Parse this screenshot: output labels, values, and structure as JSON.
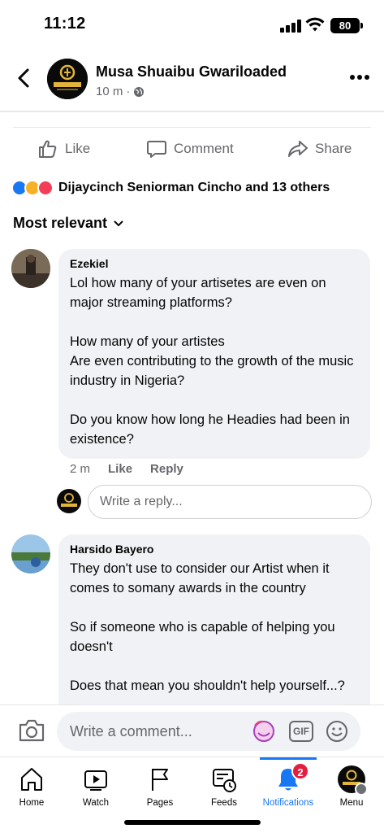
{
  "status_bar": {
    "time": "11:12",
    "battery": "80"
  },
  "header": {
    "page_name": "Musa Shuaibu Gwariloaded",
    "post_time": "10 m",
    "avatar_text": "GWARLOADED"
  },
  "actions": {
    "like": "Like",
    "comment": "Comment",
    "share": "Share"
  },
  "reactions": {
    "summary": "Dijaycinch Seniorman Cincho and 13 others"
  },
  "sort": {
    "label": "Most relevant"
  },
  "comments": [
    {
      "author": "Ezekiel",
      "text": "Lol how many of your artisetes are even on major streaming platforms?\n\nHow many of your artistes\nAre even contributing to the growth of the music industry in Nigeria?\n\nDo you know how long he Headies had been in existence?",
      "time": "2 m",
      "like": "Like",
      "reply": "Reply"
    },
    {
      "author": "Harsido Bayero",
      "text": "They don't use to consider our Artist when it comes to somany awards in the country\n\nSo if someone who is capable of helping you doesn't\n\nDoes that mean you shouldn't help yourself...?"
    }
  ],
  "reply_box": {
    "placeholder": "Write a reply..."
  },
  "composer": {
    "placeholder": "Write a comment...",
    "gif": "GIF"
  },
  "nav": {
    "home": "Home",
    "watch": "Watch",
    "pages": "Pages",
    "feeds": "Feeds",
    "notifications": "Notifications",
    "notifications_badge": "2",
    "menu": "Menu"
  },
  "colors": {
    "accent": "#1877f2",
    "badge": "#e41e3f",
    "muted": "#65676b",
    "bubble": "#f0f2f5"
  }
}
